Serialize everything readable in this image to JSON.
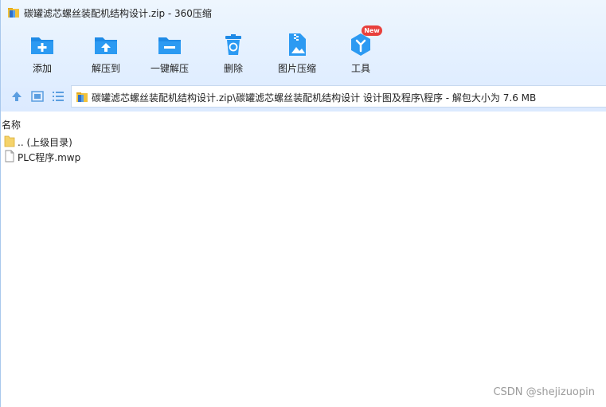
{
  "window": {
    "title": "碳罐滤芯螺丝装配机结构设计.zip - 360压缩"
  },
  "toolbar": {
    "items": [
      {
        "label": "添加",
        "icon": "add-icon"
      },
      {
        "label": "解压到",
        "icon": "extract-to-icon"
      },
      {
        "label": "一键解压",
        "icon": "one-click-extract-icon"
      },
      {
        "label": "删除",
        "icon": "delete-icon"
      },
      {
        "label": "图片压缩",
        "icon": "image-compress-icon"
      },
      {
        "label": "工具",
        "icon": "tools-icon"
      }
    ],
    "new_badge": "New"
  },
  "address": {
    "path": "碳罐滤芯螺丝装配机结构设计.zip\\碳罐滤芯螺丝装配机结构设计  设计图及程序\\程序 - 解包大小为 7.6 MB"
  },
  "list": {
    "column_name": "名称",
    "rows": [
      {
        "label": ".. (上级目录)",
        "icon": "folder-icon"
      },
      {
        "label": "PLC程序.mwp",
        "icon": "file-icon"
      }
    ]
  },
  "watermark": "CSDN @shejizuopin",
  "colors": {
    "accent": "#1e8ae6",
    "toolbar_bg": "#e2efff",
    "badge": "#e8403c"
  }
}
